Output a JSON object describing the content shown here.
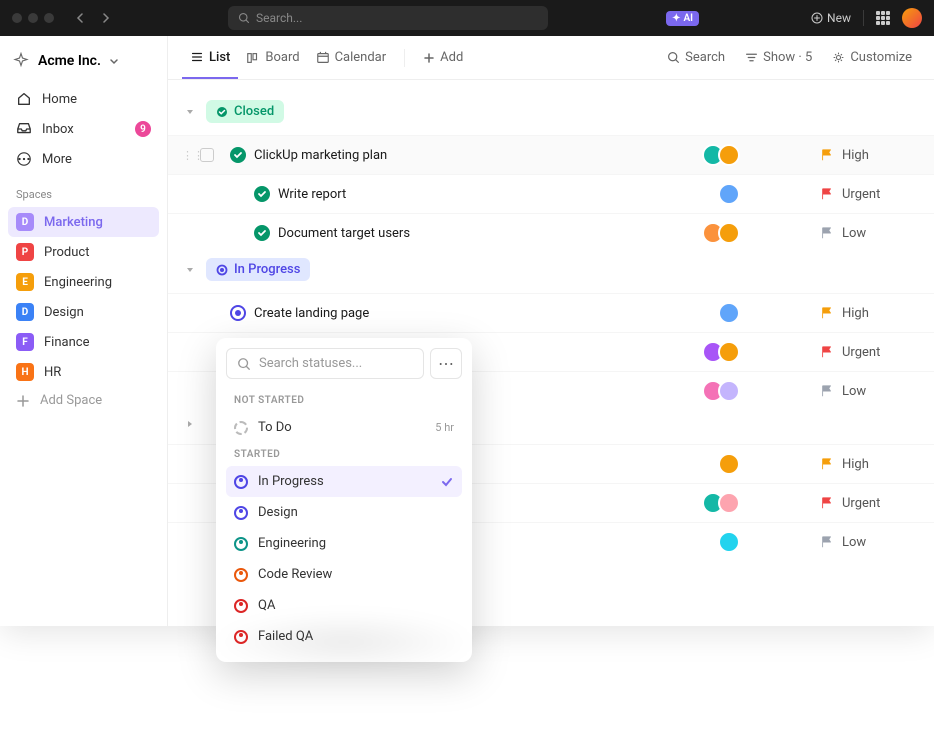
{
  "titlebar": {
    "search_placeholder": "Search...",
    "ai_label": "AI",
    "new_label": "New"
  },
  "workspace": {
    "name": "Acme Inc."
  },
  "sidebar": {
    "nav": [
      {
        "label": "Home",
        "icon": "home"
      },
      {
        "label": "Inbox",
        "icon": "inbox",
        "badge": "9"
      },
      {
        "label": "More",
        "icon": "more"
      }
    ],
    "spaces_label": "Spaces",
    "spaces": [
      {
        "label": "Marketing",
        "letter": "D",
        "color": "#a78bfa",
        "active": true
      },
      {
        "label": "Product",
        "letter": "P",
        "color": "#ef4444"
      },
      {
        "label": "Engineering",
        "letter": "E",
        "color": "#f59e0b"
      },
      {
        "label": "Design",
        "letter": "D",
        "color": "#3b82f6"
      },
      {
        "label": "Finance",
        "letter": "F",
        "color": "#8b5cf6"
      },
      {
        "label": "HR",
        "letter": "H",
        "color": "#f97316"
      }
    ],
    "add_space": "Add Space"
  },
  "toolbar": {
    "views": [
      {
        "label": "List",
        "active": true
      },
      {
        "label": "Board"
      },
      {
        "label": "Calendar"
      }
    ],
    "add": "Add",
    "search": "Search",
    "show": "Show · 5",
    "customize": "Customize"
  },
  "groups": [
    {
      "status": "Closed",
      "pill_class": "pill-closed",
      "icon": "done",
      "tasks": [
        {
          "name": "ClickUp marketing plan",
          "status": "done",
          "avatars": [
            "#14b8a6",
            "#f59e0b"
          ],
          "priority": "High",
          "flag": "#f59e0b",
          "hover": true,
          "lvl": 0
        },
        {
          "name": "Write report",
          "status": "done",
          "avatars": [
            "#60a5fa"
          ],
          "priority": "Urgent",
          "flag": "#ef4444",
          "lvl": 1
        },
        {
          "name": "Document target users",
          "status": "done",
          "avatars": [
            "#fb923c",
            "#f59e0b"
          ],
          "priority": "Low",
          "flag": "#9ca3af",
          "lvl": 1
        }
      ]
    },
    {
      "status": "In Progress",
      "pill_class": "pill-progress",
      "icon": "progress",
      "tasks": [
        {
          "name": "Create landing page",
          "status": "progress",
          "avatars": [
            "#60a5fa"
          ],
          "priority": "High",
          "flag": "#f59e0b",
          "lvl": 0
        },
        {
          "name": "",
          "status": "progress",
          "avatars": [
            "#a855f7",
            "#f59e0b"
          ],
          "priority": "Urgent",
          "flag": "#ef4444",
          "lvl": 1,
          "hidden_name": true
        },
        {
          "name": "",
          "status": "progress",
          "avatars": [
            "#f472b6",
            "#c4b5fd"
          ],
          "priority": "Low",
          "flag": "#9ca3af",
          "lvl": 1,
          "hidden_name": true
        }
      ]
    },
    {
      "status": "",
      "collapsed_only": true,
      "tasks": [
        {
          "name": "",
          "avatars": [
            "#f59e0b"
          ],
          "priority": "High",
          "flag": "#f59e0b",
          "lvl": 0,
          "hidden_name": true
        },
        {
          "name": "",
          "avatars": [
            "#14b8a6",
            "#fda4af"
          ],
          "priority": "Urgent",
          "flag": "#ef4444",
          "lvl": 1,
          "hidden_name": true
        },
        {
          "name": "",
          "avatars": [
            "#22d3ee"
          ],
          "priority": "Low",
          "flag": "#9ca3af",
          "lvl": 1,
          "hidden_name": true
        }
      ]
    }
  ],
  "popover": {
    "search_placeholder": "Search statuses...",
    "sections": [
      {
        "label": "NOT STARTED",
        "items": [
          {
            "label": "To Do",
            "color": "#bbb",
            "dashed": true,
            "meta": "5 hr"
          }
        ]
      },
      {
        "label": "STARTED",
        "items": [
          {
            "label": "In Progress",
            "color": "#4f46e5",
            "selected": true
          },
          {
            "label": "Design",
            "color": "#4f46e5"
          },
          {
            "label": "Engineering",
            "color": "#0d9488"
          },
          {
            "label": "Code Review",
            "color": "#ea580c"
          },
          {
            "label": "QA",
            "color": "#dc2626"
          },
          {
            "label": "Failed QA",
            "color": "#dc2626"
          }
        ]
      }
    ]
  }
}
